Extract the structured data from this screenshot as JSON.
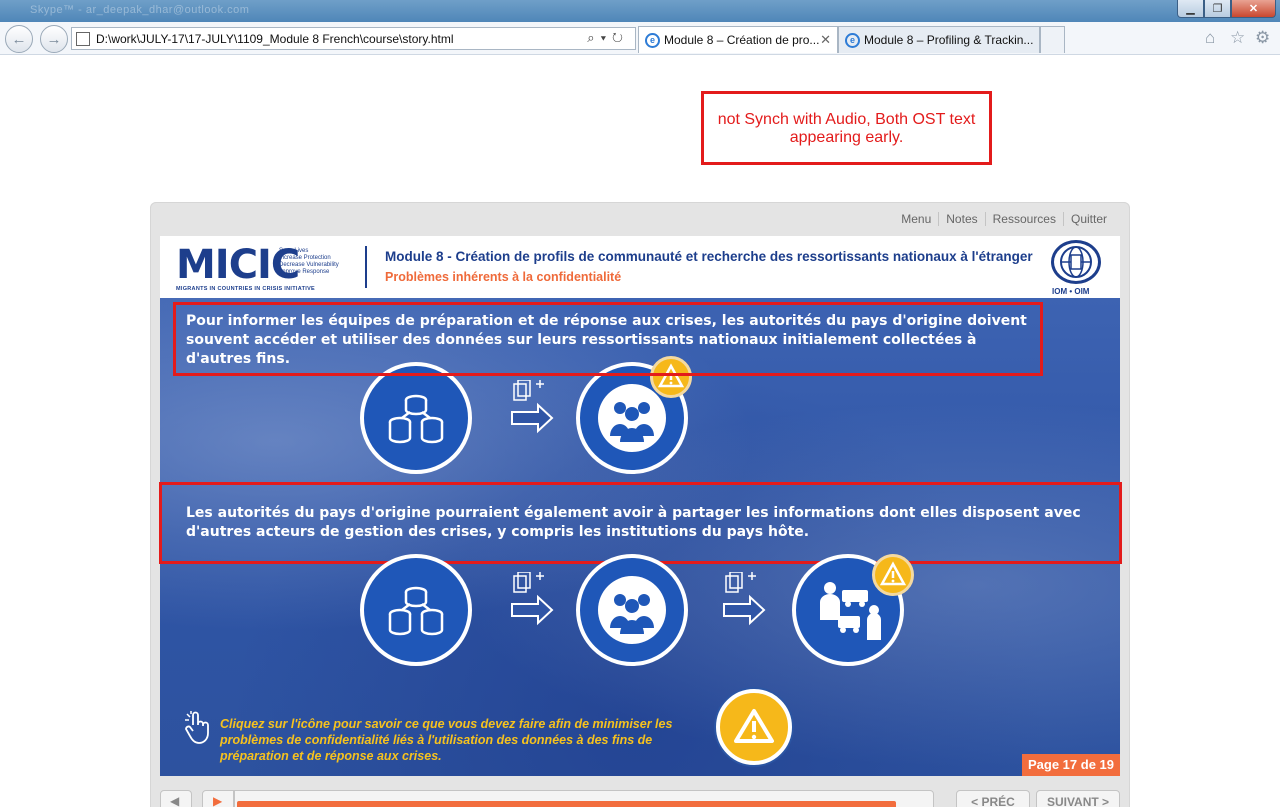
{
  "window": {
    "title_blur": "Skype™ - ar_deepak_dhar@outlook.com"
  },
  "browser": {
    "address": "D:\\work\\JULY-17\\17-JULY\\1109_Module 8 French\\course\\story.html",
    "tabs": [
      {
        "label": "Module 8 – Création de pro...",
        "active": true
      },
      {
        "label": "Module 8 – Profiling & Trackin...",
        "active": false
      }
    ]
  },
  "annotation": {
    "text": "not Synch with Audio, Both OST text appearing early."
  },
  "player": {
    "menu": [
      "Menu",
      "Notes",
      "Ressources",
      "Quitter"
    ],
    "header": {
      "logo_text": "MICIC",
      "logo_taglines": [
        "Save Lives",
        "Increase Protection",
        "Decrease Vulnerability",
        "Improve Response"
      ],
      "logo_sub": "MIGRANTS IN COUNTRIES IN CRISIS INITIATIVE",
      "title": "Module 8 - Création de profils de communauté et recherche des ressortissants nationaux à l'étranger",
      "subtitle": "Problèmes inhérents à la confidentialité",
      "iom_label": "IOM • OIM"
    },
    "ost1": "Pour informer les équipes de préparation et de réponse aux crises, les autorités du pays d'origine doivent souvent accéder et utiliser des données sur leurs ressortissants nationaux initialement collectées à d'autres fins.",
    "ost2": "Les autorités du pays d'origine pourraient également avoir à partager les informations dont elles disposent avec d'autres acteurs de gestion des crises, y compris les institutions du pays hôte.",
    "instruction": "Cliquez sur l'icône pour savoir ce que vous devez faire afin de minimiser les problèmes de confidentialité liés à l'utilisation des données à des fins de préparation et de réponse aux crises.",
    "page_label": "Page 17 de 19",
    "prev_label": "< PRÉC",
    "next_label": "SUIVANT >",
    "progress": 0.95
  }
}
